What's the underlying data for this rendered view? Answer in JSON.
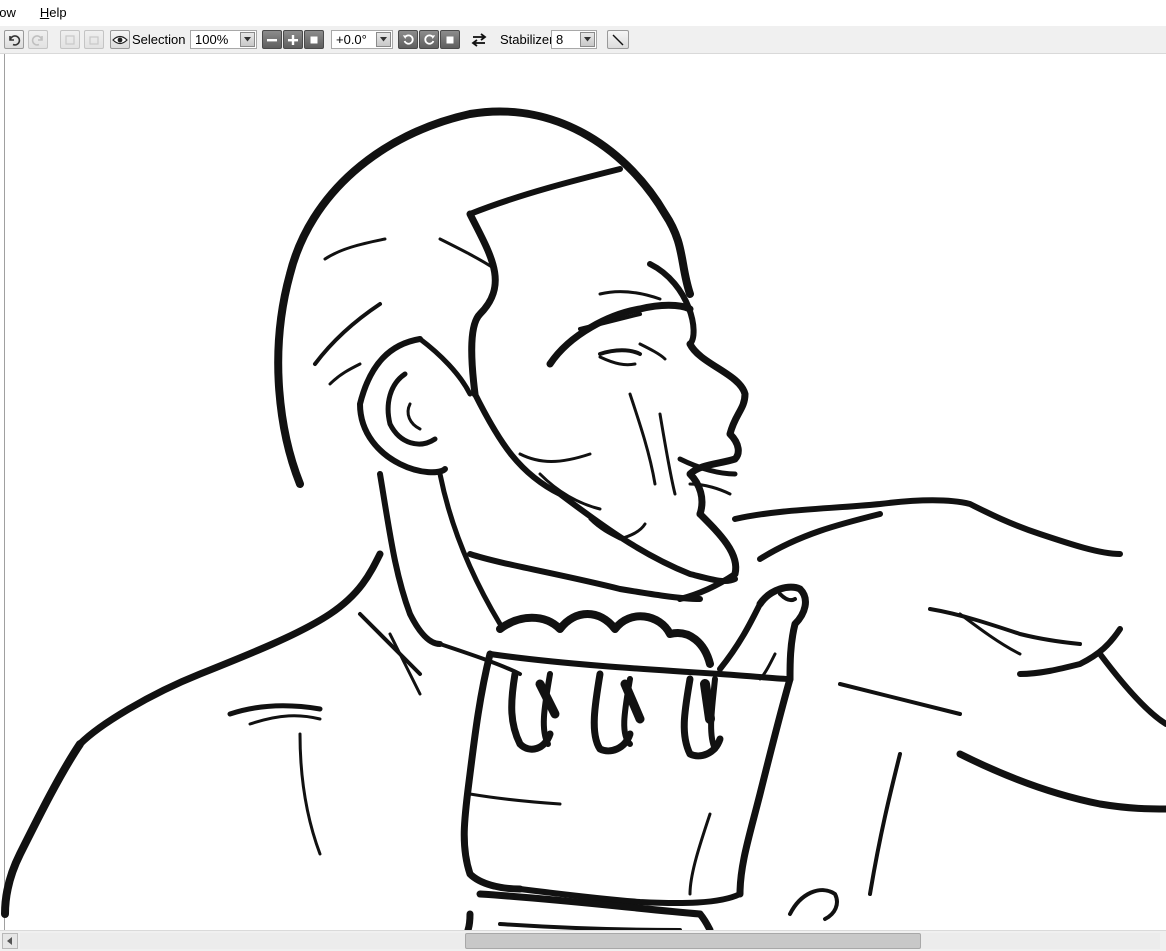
{
  "menubar": {
    "items": [
      {
        "label": "dow"
      },
      {
        "label": "Help"
      }
    ]
  },
  "toolbar": {
    "selection_label": "Selection",
    "zoom": {
      "value": "100%"
    },
    "rotation": {
      "value": "+0.0°"
    },
    "stabilizer_label": "Stabilizer",
    "stabilizer": {
      "value": "8"
    },
    "icons": {
      "undo": "undo-icon",
      "redo": "redo-icon",
      "view": "eye-icon",
      "zoom_out": "minus-icon",
      "zoom_in": "plus-icon",
      "zoom_reset": "square-icon",
      "rotate_ccw": "rotate-left-icon",
      "rotate_cw": "rotate-right-icon",
      "rotate_reset": "square-icon",
      "flip": "swap-arrows-icon",
      "line": "line-tool-icon"
    }
  },
  "scrollbar": {
    "thumb_start": 0.39,
    "thumb_end": 0.79
  },
  "colors": {
    "ink": "#111111",
    "canvas": "#ffffff",
    "chrome": "#f0f0f0"
  }
}
